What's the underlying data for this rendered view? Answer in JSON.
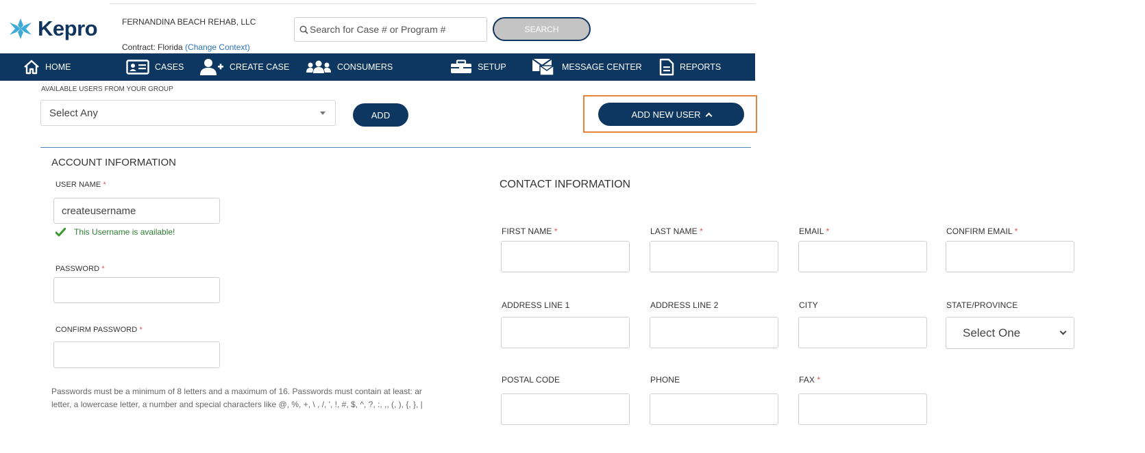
{
  "header": {
    "logo_text": "Kepro",
    "org_name": "FERNANDINA BEACH REHAB, LLC",
    "contract_prefix": "Contract: Florida",
    "change_context": "(Change Context)",
    "search_placeholder": "Search for Case # or Program #",
    "search_button": "SEARCH"
  },
  "nav": {
    "home": "HOME",
    "cases": "CASES",
    "create_case": "CREATE CASE",
    "consumers": "CONSUMERS",
    "setup": "SETUP",
    "message_center": "MESSAGE CENTER",
    "reports": "REPORTS"
  },
  "available_users": {
    "label": "AVAILABLE USERS FROM YOUR GROUP",
    "selected": "Select Any",
    "add_button": "ADD",
    "add_new_user_button": "ADD NEW USER"
  },
  "account": {
    "title": "ACCOUNT INFORMATION",
    "username_label": "USER NAME",
    "username_value": "createusername",
    "username_available": "This Username is available!",
    "password_label": "PASSWORD",
    "confirm_password_label": "CONFIRM PASSWORD",
    "required_mark": "*",
    "password_note_line1": "Passwords must be a minimum of 8 letters and a maximum of 16. Passwords must contain at least: ar",
    "password_note_line2": "letter, a lowercase letter, a number and special characters like @, %, +, \\ , /, ', !, #, $, ^, ?, :, ,, (, ), {, }, |"
  },
  "contact": {
    "title": "CONTACT INFORMATION",
    "first_name": "FIRST NAME",
    "last_name": "LAST NAME",
    "email": "EMAIL",
    "confirm_email": "CONFIRM EMAIL",
    "address1": "ADDRESS LINE 1",
    "address2": "ADDRESS LINE 2",
    "city": "CITY",
    "state": "STATE/PROVINCE",
    "state_selected": "Select One",
    "postal_code": "POSTAL CODE",
    "phone": "PHONE",
    "fax": "FAX"
  },
  "colors": {
    "brand_navy": "#0d3761",
    "highlight_orange": "#e6843b",
    "required_red": "#d9534f",
    "success_green": "#2e7d32",
    "link_blue": "#2a74b8"
  },
  "icons": {
    "logo": "kepro-star-icon",
    "search": "search-icon",
    "home": "home-icon",
    "cases": "id-card-icon",
    "create_case": "add-user-icon",
    "consumers": "users-group-icon",
    "setup": "toolbox-icon",
    "message_center": "message-center-icon",
    "reports": "document-icon",
    "available": "checkmark-icon"
  }
}
